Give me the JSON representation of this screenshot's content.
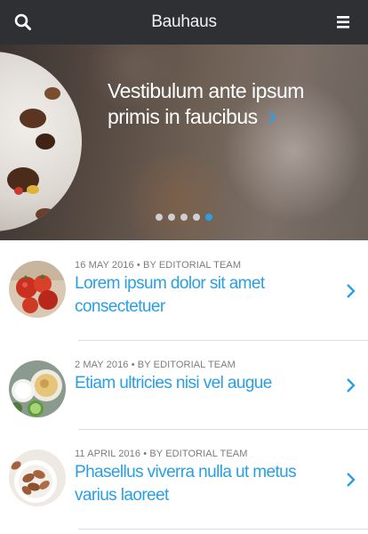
{
  "header": {
    "title": "Bauhaus",
    "icons": {
      "search": "search-icon",
      "menu": "hamburger-menu-icon"
    }
  },
  "hero": {
    "headline": "Vestibulum ante ipsum primis in faucibus",
    "next_icon": "chevron-right-icon",
    "slide_count": 5,
    "active_slide": 5
  },
  "articles": [
    {
      "date": "16 MAY 2016",
      "author": "BY EDITORIAL TEAM",
      "title": "Lorem ipsum dolor sit amet consectetuer",
      "thumb": "tomatoes"
    },
    {
      "date": "2 MAY 2016",
      "author": "BY EDITORIAL TEAM",
      "title": "Etiam ultricies nisi vel augue",
      "thumb": "dip-bowls"
    },
    {
      "date": "11 APRIL 2016",
      "author": "BY EDITORIAL TEAM",
      "title": "Phasellus viverra nulla ut metus varius laoreet",
      "thumb": "almonds"
    }
  ],
  "separator": "•",
  "colors": {
    "header_bg": "#2f3033",
    "accent": "#2a9fe6",
    "meta": "#7c7c7c"
  }
}
